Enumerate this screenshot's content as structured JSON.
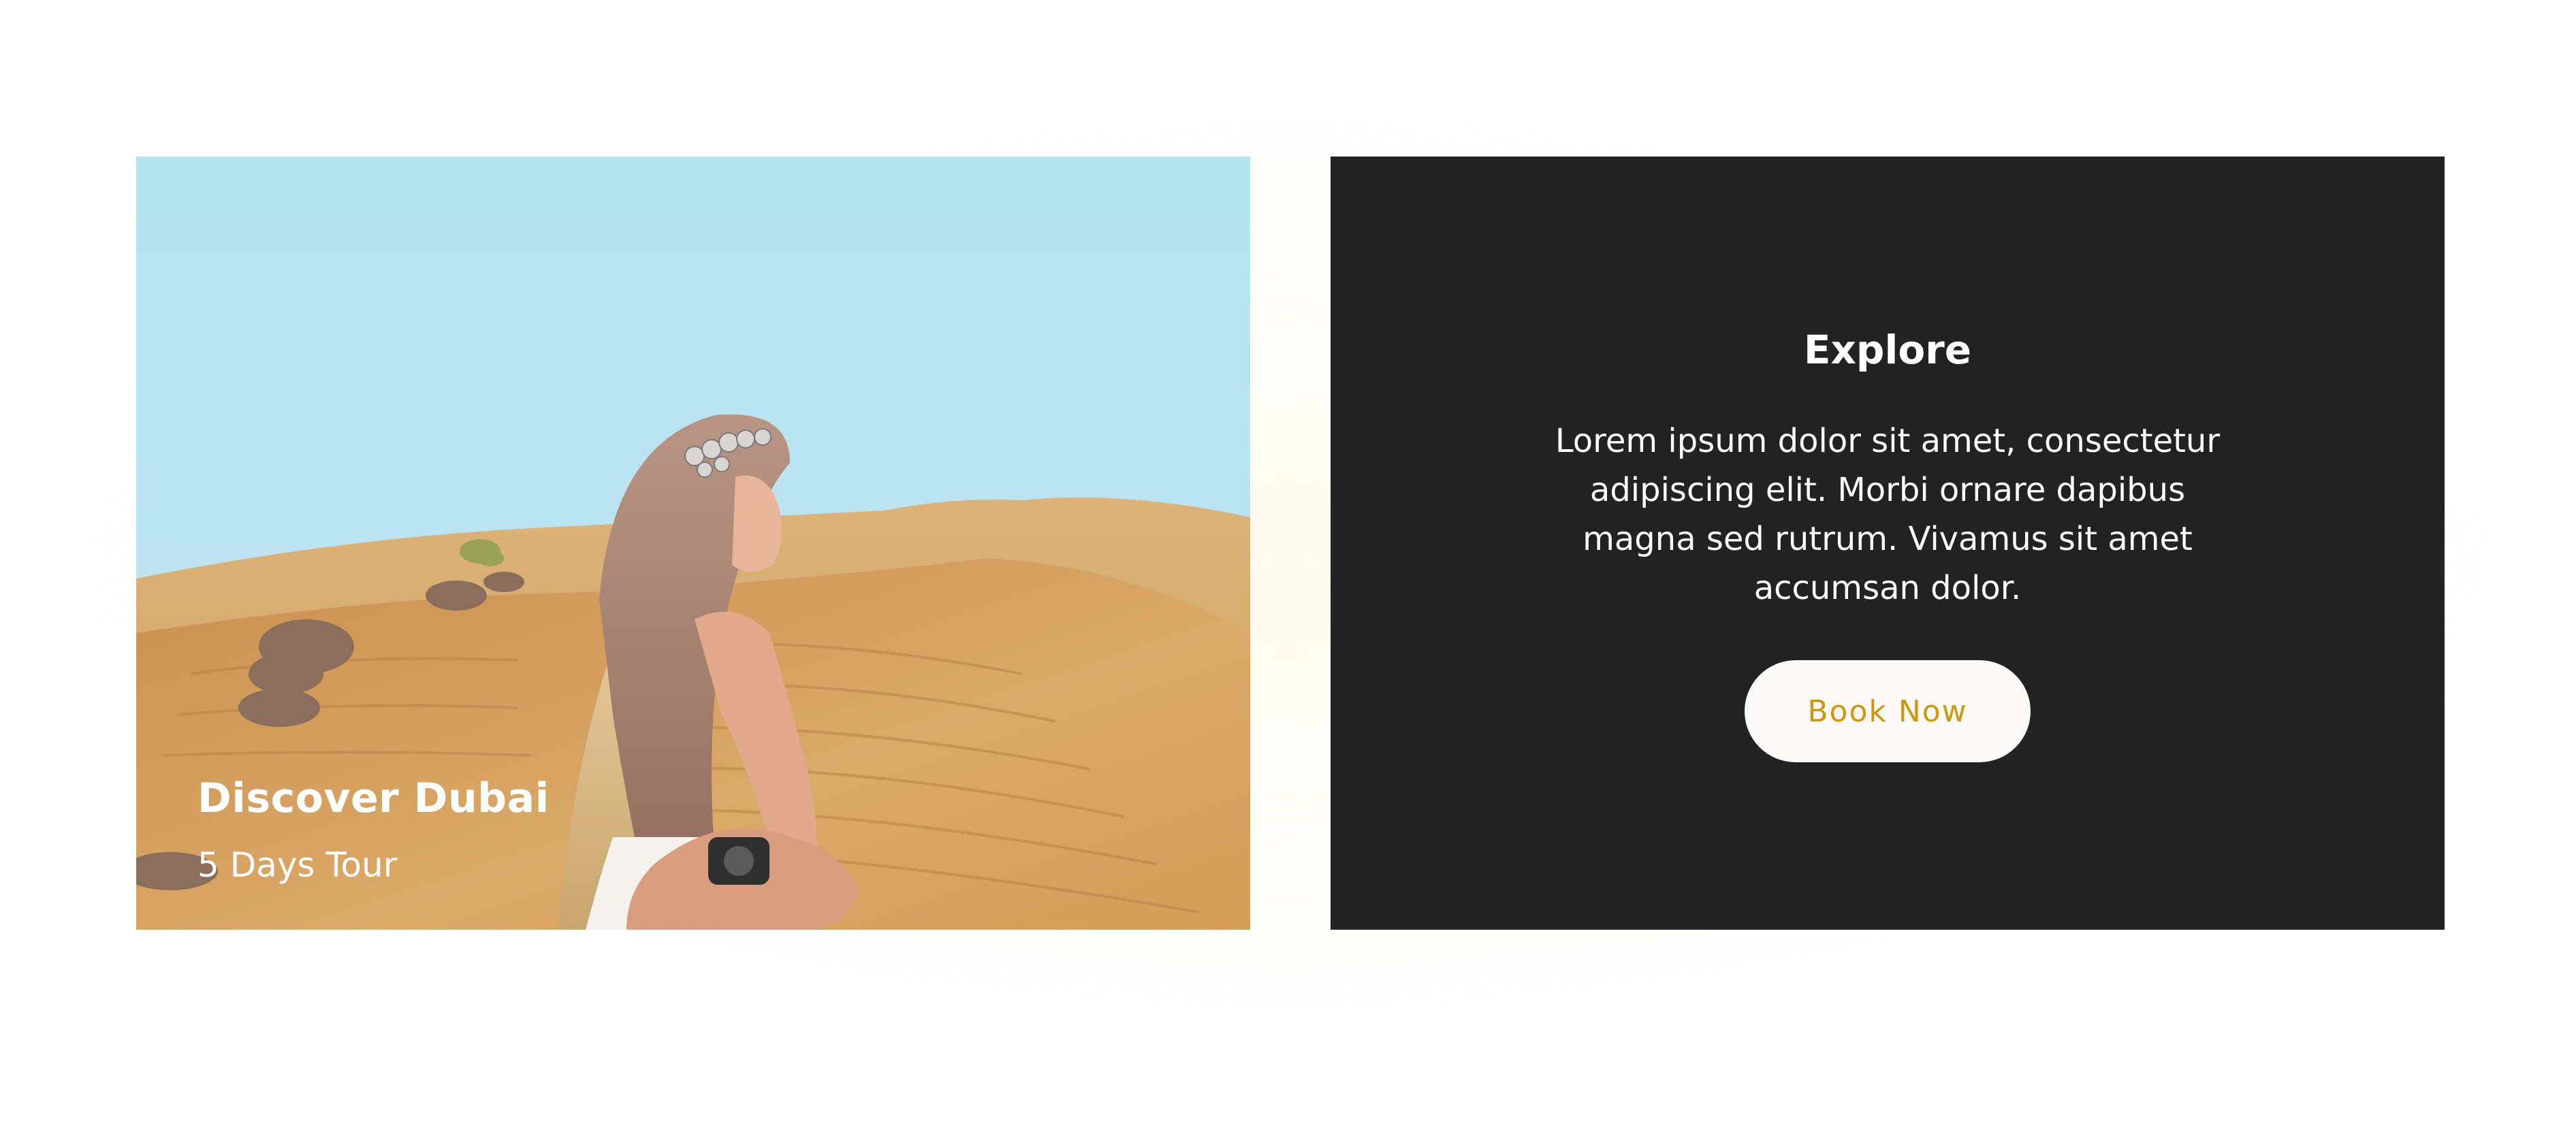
{
  "tour_card": {
    "title": "Discover Dubai",
    "subtitle": "5 Days Tour"
  },
  "explore_card": {
    "title": "Explore",
    "body": "Lorem ipsum dolor sit amet, consectetur adipiscing elit. Morbi ornare dapibus magna sed rutrum. Vivamus sit amet accumsan dolor.",
    "button_label": "Book Now"
  },
  "colors": {
    "panel_bg": "#222222",
    "button_bg": "#fbfaf8",
    "button_text": "#d1960f",
    "sky": "#b5e3ef",
    "sand": "#d5a25d"
  }
}
